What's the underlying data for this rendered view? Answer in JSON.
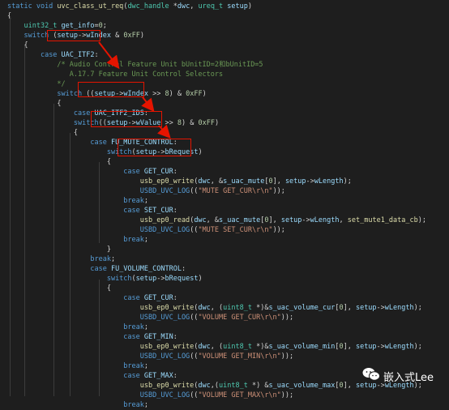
{
  "code_lines": [
    [
      {
        "c": "kw",
        "t": "static "
      },
      {
        "c": "kw",
        "t": "void "
      },
      {
        "c": "fn",
        "t": "uvc_class_ut_req"
      },
      {
        "c": "pu",
        "t": "("
      },
      {
        "c": "ty",
        "t": "dwc_handle "
      },
      {
        "c": "pu",
        "t": "*"
      },
      {
        "c": "va",
        "t": "dwc"
      },
      {
        "c": "pu",
        "t": ", "
      },
      {
        "c": "ty",
        "t": "ureq_t "
      },
      {
        "c": "va",
        "t": "setup"
      },
      {
        "c": "pu",
        "t": ")"
      }
    ],
    [
      {
        "c": "pu",
        "t": "{"
      }
    ],
    [
      {
        "c": "pu",
        "t": "    "
      },
      {
        "c": "ty",
        "t": "uint32_t "
      },
      {
        "c": "va",
        "t": "get_info"
      },
      {
        "c": "pu",
        "t": "="
      },
      {
        "c": "nu",
        "t": "0"
      },
      {
        "c": "pu",
        "t": ";"
      }
    ],
    [
      {
        "c": "pu",
        "t": "    "
      },
      {
        "c": "kw",
        "t": "switch "
      },
      {
        "c": "pu",
        "t": "("
      },
      {
        "c": "va",
        "t": "setup"
      },
      {
        "c": "pu",
        "t": "->"
      },
      {
        "c": "va",
        "t": "wIndex"
      },
      {
        "c": "pu",
        "t": " & "
      },
      {
        "c": "nu",
        "t": "0xFF"
      },
      {
        "c": "pu",
        "t": ")"
      }
    ],
    [
      {
        "c": "pu",
        "t": "    {"
      }
    ],
    [
      {
        "c": "pu",
        "t": "        "
      },
      {
        "c": "kw",
        "t": "case "
      },
      {
        "c": "va",
        "t": "UAC_ITF2"
      },
      {
        "c": "pu",
        "t": ":"
      }
    ],
    [
      {
        "c": "cm",
        "t": "            /* Audio Control Feature Unit bUnitID=2和bUnitID=5"
      }
    ],
    [
      {
        "c": "cm",
        "t": "               A.17.7 Feature Unit Control Selectors"
      }
    ],
    [
      {
        "c": "cm",
        "t": "            */"
      }
    ],
    [
      {
        "c": "pu",
        "t": "            "
      },
      {
        "c": "kw",
        "t": "switch "
      },
      {
        "c": "pu",
        "t": "(("
      },
      {
        "c": "va",
        "t": "setup"
      },
      {
        "c": "pu",
        "t": "->"
      },
      {
        "c": "va",
        "t": "wIndex"
      },
      {
        "c": "pu",
        "t": " >> "
      },
      {
        "c": "nu",
        "t": "8"
      },
      {
        "c": "pu",
        "t": ") & "
      },
      {
        "c": "nu",
        "t": "0xFF"
      },
      {
        "c": "pu",
        "t": ")"
      }
    ],
    [
      {
        "c": "pu",
        "t": "            {"
      }
    ],
    [
      {
        "c": "pu",
        "t": "                "
      },
      {
        "c": "kw",
        "t": "case "
      },
      {
        "c": "va",
        "t": "UAC_ITF2_IDS"
      },
      {
        "c": "pu",
        "t": ":"
      }
    ],
    [
      {
        "c": "pu",
        "t": "                "
      },
      {
        "c": "kw",
        "t": "switch"
      },
      {
        "c": "pu",
        "t": "(("
      },
      {
        "c": "va",
        "t": "setup"
      },
      {
        "c": "pu",
        "t": "->"
      },
      {
        "c": "va",
        "t": "wValue"
      },
      {
        "c": "pu",
        "t": " >> "
      },
      {
        "c": "nu",
        "t": "8"
      },
      {
        "c": "pu",
        "t": ") & "
      },
      {
        "c": "nu",
        "t": "0xFF"
      },
      {
        "c": "pu",
        "t": ")"
      }
    ],
    [
      {
        "c": "pu",
        "t": "                {"
      }
    ],
    [
      {
        "c": "pu",
        "t": "                    "
      },
      {
        "c": "kw",
        "t": "case "
      },
      {
        "c": "va",
        "t": "FU_MUTE_CONTROL"
      },
      {
        "c": "pu",
        "t": ":"
      }
    ],
    [
      {
        "c": "pu",
        "t": "                        "
      },
      {
        "c": "kw",
        "t": "switch"
      },
      {
        "c": "pu",
        "t": "("
      },
      {
        "c": "va",
        "t": "setup"
      },
      {
        "c": "pu",
        "t": "->"
      },
      {
        "c": "va",
        "t": "bRequest"
      },
      {
        "c": "pu",
        "t": ")"
      }
    ],
    [
      {
        "c": "pu",
        "t": "                        {"
      }
    ],
    [
      {
        "c": "pu",
        "t": "                            "
      },
      {
        "c": "kw",
        "t": "case "
      },
      {
        "c": "va",
        "t": "GET_CUR"
      },
      {
        "c": "pu",
        "t": ":"
      }
    ],
    [
      {
        "c": "pu",
        "t": "                                "
      },
      {
        "c": "fn",
        "t": "usb_ep0_write"
      },
      {
        "c": "pu",
        "t": "("
      },
      {
        "c": "va",
        "t": "dwc"
      },
      {
        "c": "pu",
        "t": ", &"
      },
      {
        "c": "va",
        "t": "s_uac_mute"
      },
      {
        "c": "pu",
        "t": "["
      },
      {
        "c": "nu",
        "t": "0"
      },
      {
        "c": "pu",
        "t": "], "
      },
      {
        "c": "va",
        "t": "setup"
      },
      {
        "c": "pu",
        "t": "->"
      },
      {
        "c": "va",
        "t": "wLength"
      },
      {
        "c": "pu",
        "t": ");"
      }
    ],
    [
      {
        "c": "pu",
        "t": "                                "
      },
      {
        "c": "kw",
        "t": "USBD_UVC_LOG"
      },
      {
        "c": "pu",
        "t": "(("
      },
      {
        "c": "st",
        "t": "\"MUTE GET_CUR\\r\\n\""
      },
      {
        "c": "pu",
        "t": "));"
      }
    ],
    [
      {
        "c": "pu",
        "t": "                            "
      },
      {
        "c": "kw",
        "t": "break"
      },
      {
        "c": "pu",
        "t": ";"
      }
    ],
    [
      {
        "c": "pu",
        "t": "                            "
      },
      {
        "c": "kw",
        "t": "case "
      },
      {
        "c": "va",
        "t": "SET_CUR"
      },
      {
        "c": "pu",
        "t": ":"
      }
    ],
    [
      {
        "c": "pu",
        "t": "                                "
      },
      {
        "c": "fn",
        "t": "usb_ep0_read"
      },
      {
        "c": "pu",
        "t": "("
      },
      {
        "c": "va",
        "t": "dwc"
      },
      {
        "c": "pu",
        "t": ", &"
      },
      {
        "c": "va",
        "t": "s_uac_mute"
      },
      {
        "c": "pu",
        "t": "["
      },
      {
        "c": "nu",
        "t": "0"
      },
      {
        "c": "pu",
        "t": "], "
      },
      {
        "c": "va",
        "t": "setup"
      },
      {
        "c": "pu",
        "t": "->"
      },
      {
        "c": "va",
        "t": "wLength"
      },
      {
        "c": "pu",
        "t": ", "
      },
      {
        "c": "fn",
        "t": "set_mute1_data_cb"
      },
      {
        "c": "pu",
        "t": ");"
      }
    ],
    [
      {
        "c": "pu",
        "t": "                                "
      },
      {
        "c": "kw",
        "t": "USBD_UVC_LOG"
      },
      {
        "c": "pu",
        "t": "(("
      },
      {
        "c": "st",
        "t": "\"MUTE SET_CUR\\r\\n\""
      },
      {
        "c": "pu",
        "t": "));"
      }
    ],
    [
      {
        "c": "pu",
        "t": "                            "
      },
      {
        "c": "kw",
        "t": "break"
      },
      {
        "c": "pu",
        "t": ";"
      }
    ],
    [
      {
        "c": "pu",
        "t": "                        }"
      }
    ],
    [
      {
        "c": "pu",
        "t": "                    "
      },
      {
        "c": "kw",
        "t": "break"
      },
      {
        "c": "pu",
        "t": ";"
      }
    ],
    [
      {
        "c": "pu",
        "t": "                    "
      },
      {
        "c": "kw",
        "t": "case "
      },
      {
        "c": "va",
        "t": "FU_VOLUME_CONTROL"
      },
      {
        "c": "pu",
        "t": ":"
      }
    ],
    [
      {
        "c": "pu",
        "t": "                        "
      },
      {
        "c": "kw",
        "t": "switch"
      },
      {
        "c": "pu",
        "t": "("
      },
      {
        "c": "va",
        "t": "setup"
      },
      {
        "c": "pu",
        "t": "->"
      },
      {
        "c": "va",
        "t": "bRequest"
      },
      {
        "c": "pu",
        "t": ")"
      }
    ],
    [
      {
        "c": "pu",
        "t": "                        {"
      }
    ],
    [
      {
        "c": "pu",
        "t": "                            "
      },
      {
        "c": "kw",
        "t": "case "
      },
      {
        "c": "va",
        "t": "GET_CUR"
      },
      {
        "c": "pu",
        "t": ":"
      }
    ],
    [
      {
        "c": "pu",
        "t": "                                "
      },
      {
        "c": "fn",
        "t": "usb_ep0_write"
      },
      {
        "c": "pu",
        "t": "("
      },
      {
        "c": "va",
        "t": "dwc"
      },
      {
        "c": "pu",
        "t": ", ("
      },
      {
        "c": "ty",
        "t": "uint8_t "
      },
      {
        "c": "pu",
        "t": "*)&"
      },
      {
        "c": "va",
        "t": "s_uac_volume_cur"
      },
      {
        "c": "pu",
        "t": "["
      },
      {
        "c": "nu",
        "t": "0"
      },
      {
        "c": "pu",
        "t": "], "
      },
      {
        "c": "va",
        "t": "setup"
      },
      {
        "c": "pu",
        "t": "->"
      },
      {
        "c": "va",
        "t": "wLength"
      },
      {
        "c": "pu",
        "t": ");"
      }
    ],
    [
      {
        "c": "pu",
        "t": "                                "
      },
      {
        "c": "kw",
        "t": "USBD_UVC_LOG"
      },
      {
        "c": "pu",
        "t": "(("
      },
      {
        "c": "st",
        "t": "\"VOLUME GET_CUR\\r\\n\""
      },
      {
        "c": "pu",
        "t": "));"
      }
    ],
    [
      {
        "c": "pu",
        "t": "                            "
      },
      {
        "c": "kw",
        "t": "break"
      },
      {
        "c": "pu",
        "t": ";"
      }
    ],
    [
      {
        "c": "pu",
        "t": "                            "
      },
      {
        "c": "kw",
        "t": "case "
      },
      {
        "c": "va",
        "t": "GET_MIN"
      },
      {
        "c": "pu",
        "t": ":"
      }
    ],
    [
      {
        "c": "pu",
        "t": "                                "
      },
      {
        "c": "fn",
        "t": "usb_ep0_write"
      },
      {
        "c": "pu",
        "t": "("
      },
      {
        "c": "va",
        "t": "dwc"
      },
      {
        "c": "pu",
        "t": ", ("
      },
      {
        "c": "ty",
        "t": "uint8_t "
      },
      {
        "c": "pu",
        "t": "*)&"
      },
      {
        "c": "va",
        "t": "s_uac_volume_min"
      },
      {
        "c": "pu",
        "t": "["
      },
      {
        "c": "nu",
        "t": "0"
      },
      {
        "c": "pu",
        "t": "], "
      },
      {
        "c": "va",
        "t": "setup"
      },
      {
        "c": "pu",
        "t": "->"
      },
      {
        "c": "va",
        "t": "wLength"
      },
      {
        "c": "pu",
        "t": ");"
      }
    ],
    [
      {
        "c": "pu",
        "t": "                                "
      },
      {
        "c": "kw",
        "t": "USBD_UVC_LOG"
      },
      {
        "c": "pu",
        "t": "(("
      },
      {
        "c": "st",
        "t": "\"VOLUME GET_MIN\\r\\n\""
      },
      {
        "c": "pu",
        "t": "));"
      }
    ],
    [
      {
        "c": "pu",
        "t": "                            "
      },
      {
        "c": "kw",
        "t": "break"
      },
      {
        "c": "pu",
        "t": ";"
      }
    ],
    [
      {
        "c": "pu",
        "t": "                            "
      },
      {
        "c": "kw",
        "t": "case "
      },
      {
        "c": "va",
        "t": "GET_MAX"
      },
      {
        "c": "pu",
        "t": ":"
      }
    ],
    [
      {
        "c": "pu",
        "t": "                                "
      },
      {
        "c": "fn",
        "t": "usb_ep0_write"
      },
      {
        "c": "pu",
        "t": "("
      },
      {
        "c": "va",
        "t": "dwc"
      },
      {
        "c": "pu",
        "t": ",("
      },
      {
        "c": "ty",
        "t": "uint8_t "
      },
      {
        "c": "pu",
        "t": "*) &"
      },
      {
        "c": "va",
        "t": "s_uac_volume_max"
      },
      {
        "c": "pu",
        "t": "["
      },
      {
        "c": "nu",
        "t": "0"
      },
      {
        "c": "pu",
        "t": "], "
      },
      {
        "c": "va",
        "t": "setup"
      },
      {
        "c": "pu",
        "t": "->"
      },
      {
        "c": "va",
        "t": "wLength"
      },
      {
        "c": "pu",
        "t": ");"
      }
    ],
    [
      {
        "c": "pu",
        "t": "                                "
      },
      {
        "c": "kw",
        "t": "USBD_UVC_LOG"
      },
      {
        "c": "pu",
        "t": "(("
      },
      {
        "c": "st",
        "t": "\"VOLUME GET_MAX\\r\\n\""
      },
      {
        "c": "pu",
        "t": "));"
      }
    ],
    [
      {
        "c": "pu",
        "t": "                            "
      },
      {
        "c": "kw",
        "t": "break"
      },
      {
        "c": "pu",
        "t": ";"
      }
    ]
  ],
  "watermark": {
    "icon": "wechat-icon",
    "text": "嵌入式Lee"
  },
  "colors": {
    "background": "#1e1e1e",
    "keyword": "#569cd6",
    "type": "#4ec9b0",
    "function": "#dcdcaa",
    "variable": "#9cdcfe",
    "number": "#b5cea8",
    "string": "#ce9178",
    "comment": "#6a9955",
    "highlight": "#e51400"
  }
}
